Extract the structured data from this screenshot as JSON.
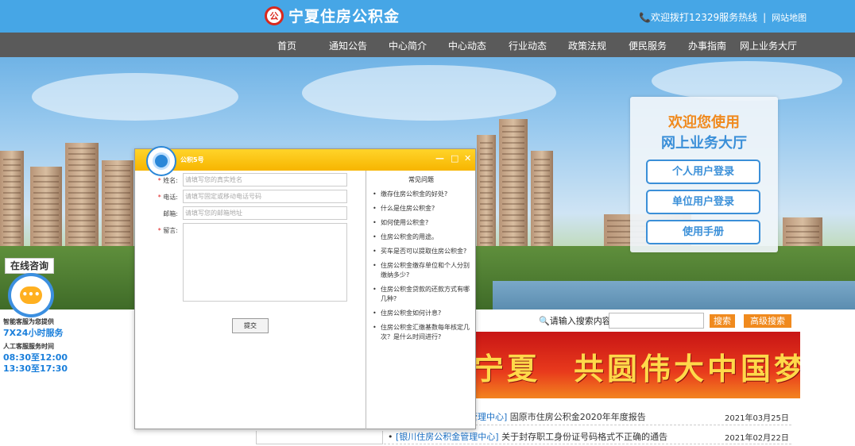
{
  "header": {
    "logo_emblem": "公",
    "site_title": "宁夏住房公积金",
    "hotline": "📞欢迎拨打12329服务热线",
    "separator": "|",
    "sitemap": "网站地图"
  },
  "nav": {
    "items": [
      "首页",
      "通知公告",
      "中心简介",
      "中心动态",
      "行业动态",
      "政策法规",
      "便民服务",
      "办事指南",
      "网上业务大厅"
    ]
  },
  "welcome": {
    "line1": "欢迎您使用",
    "line2": "网上业务大厅",
    "buttons": [
      "个人用户登录",
      "单位用户登录",
      "使用手册"
    ]
  },
  "consult": {
    "label": "在线咨询",
    "icon_text": "•••",
    "line1": "智能客服为您提供",
    "line2": "7X24小时服务",
    "line3": "人工客服服务时间",
    "line4": "08:30至12:00",
    "line5": "13:30至17:30"
  },
  "search": {
    "label": "请输入搜索内容：",
    "search_button": "搜索",
    "advanced_button": "高级搜索"
  },
  "slogan": {
    "text": "宁夏　共圆伟大中国梦"
  },
  "news": [
    {
      "source": "管理中心]",
      "title": " 固原市住房公积金2020年年度报告",
      "date": "2021年03月25日"
    },
    {
      "source": "[银川住房公积金管理中心]",
      "title": " 关于封存职工身份证号码格式不正确的通告",
      "date": "2021年02月22日"
    }
  ],
  "dialog": {
    "title": "公积5号",
    "controls": [
      "—",
      "□",
      "✕"
    ],
    "form": {
      "name_label": "姓名:",
      "name_placeholder": "请填写您的真实姓名",
      "phone_label": "电话:",
      "phone_placeholder": "请填写固定或移动电话号码",
      "email_label": "邮箱:",
      "email_placeholder": "请填写您的邮箱地址",
      "message_label": "留言:",
      "required_mark": "*",
      "submit": "提交"
    },
    "faq": {
      "title": "常见问题",
      "items": [
        "缴存住房公积金的好处?",
        "什么是住房公积金?",
        "如何使用公积金?",
        "住房公积金的用途。",
        "买车是否可以提取住房公积金?",
        "住房公积金缴存单位和个人分别缴纳多少?",
        "住房公积金贷款的还款方式有哪几种?",
        "住房公积金如何计息?",
        "住房公积金汇缴基数每年核定几次？是什么时间进行?"
      ]
    }
  },
  "colors": {
    "header_blue": "#46a6e6",
    "nav_gray": "#5a5a5a",
    "accent_orange": "#f08a1e",
    "dialog_yellow": "#f7b500",
    "link_blue": "#1a6fc4"
  }
}
